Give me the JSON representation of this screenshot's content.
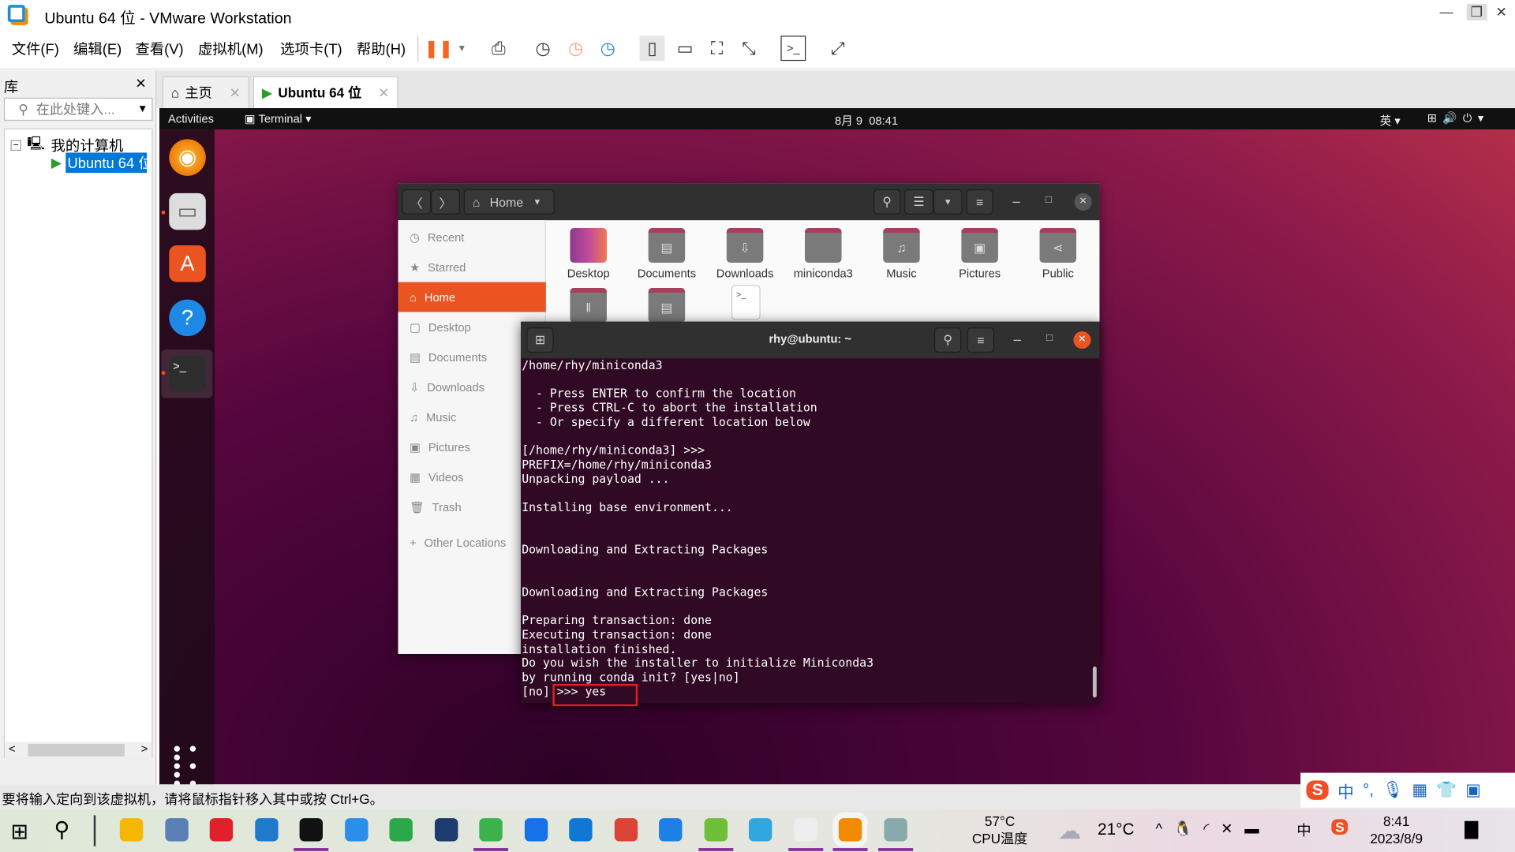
{
  "window": {
    "title": "Ubuntu 64 位 - VMware Workstation"
  },
  "menu": [
    "文件(F)",
    "编辑(E)",
    "查看(V)",
    "虚拟机(M)",
    "选项卡(T)",
    "帮助(H)"
  ],
  "library": {
    "title": "库",
    "search_placeholder": "在此处键入...",
    "tree_root": "我的计算机",
    "tree_child": "Ubuntu 64 位"
  },
  "tabs": [
    {
      "label": "主页"
    },
    {
      "label": "Ubuntu 64 位"
    }
  ],
  "gnome": {
    "activities": "Activities",
    "app": "Terminal ▾",
    "clock": "8月 9  08:41",
    "ime": "英 ▾"
  },
  "files": {
    "location": "Home",
    "sidebar": [
      "Recent",
      "Starred",
      "Home",
      "Desktop",
      "Documents",
      "Downloads",
      "Music",
      "Pictures",
      "Videos",
      "Trash",
      "Other Locations"
    ],
    "folders": [
      "Desktop",
      "Documents",
      "Downloads",
      "miniconda3",
      "Music",
      "Pictures",
      "Public"
    ]
  },
  "terminal": {
    "title": "rhy@ubuntu: ~",
    "lines": [
      "/home/rhy/miniconda3",
      "",
      "  - Press ENTER to confirm the location",
      "  - Press CTRL-C to abort the installation",
      "  - Or specify a different location below",
      "",
      "[/home/rhy/miniconda3] >>> ",
      "PREFIX=/home/rhy/miniconda3",
      "Unpacking payload ...",
      "",
      "Installing base environment...",
      "",
      "",
      "Downloading and Extracting Packages",
      "",
      "",
      "Downloading and Extracting Packages",
      "",
      "Preparing transaction: done",
      "Executing transaction: done",
      "installation finished.",
      "Do you wish the installer to initialize Miniconda3",
      "by running conda init? [yes|no]",
      "[no] >>> yes"
    ],
    "highlight_color": "#e02020"
  },
  "statusbar": {
    "message": "要将输入定向到该虚拟机，请将鼠标指针移入其中或按 Ctrl+G。"
  },
  "taskbar": {
    "cpu_temp": "57°C",
    "cpu_label": "CPU温度",
    "weather": "21°C",
    "time": "8:41",
    "date": "2023/8/9",
    "ime": "中"
  }
}
